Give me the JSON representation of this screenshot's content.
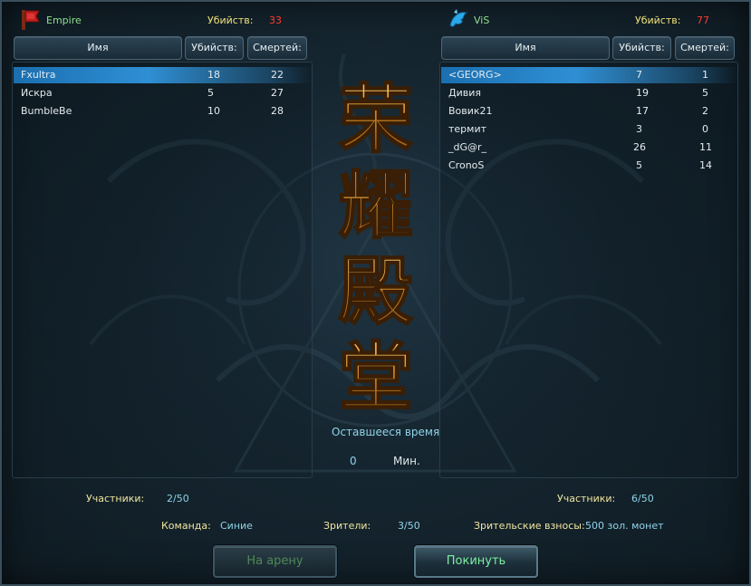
{
  "left_team": {
    "name": "Empire",
    "kills_label": "Убийств:",
    "kills": "33",
    "headers": {
      "name": "Имя",
      "kills": "Убийств:",
      "deaths": "Смертей:"
    },
    "players": [
      {
        "name": "Fxultra",
        "kills": "18",
        "deaths": "22",
        "selected": true
      },
      {
        "name": "Искра",
        "kills": "5",
        "deaths": "27",
        "selected": false
      },
      {
        "name": "BumbleBe",
        "kills": "10",
        "deaths": "28",
        "selected": false
      }
    ],
    "participants_label": "Участники:",
    "participants": "2/50"
  },
  "right_team": {
    "name": "ViS",
    "kills_label": "Убийств:",
    "kills": "77",
    "headers": {
      "name": "Имя",
      "kills": "Убийств:",
      "deaths": "Смертей:"
    },
    "players": [
      {
        "name": "<GEORG>",
        "kills": "7",
        "deaths": "1",
        "selected": true
      },
      {
        "name": "Дивия",
        "kills": "19",
        "deaths": "5",
        "selected": false
      },
      {
        "name": "Вовик21",
        "kills": "17",
        "deaths": "2",
        "selected": false
      },
      {
        "name": "термит",
        "kills": "3",
        "deaths": "0",
        "selected": false
      },
      {
        "name": "_dG@r_",
        "kills": "26",
        "deaths": "11",
        "selected": false
      },
      {
        "name": "CronoS",
        "kills": "5",
        "deaths": "14",
        "selected": false
      }
    ],
    "participants_label": "Участники:",
    "participants": "6/50"
  },
  "center": {
    "title_glyphs": [
      "荣",
      "耀",
      "殿",
      "堂"
    ],
    "time_label": "Оставшееся время",
    "time_value": "0",
    "time_unit": "Мин."
  },
  "footer": {
    "team_label": "Команда:",
    "team_value": "Синие",
    "spectators_label": "Зрители:",
    "spectators_value": "3/50",
    "fee_label": "Зрительские взносы:",
    "fee_value": "500 зол. монет"
  },
  "buttons": {
    "to_arena": "На арену",
    "leave": "Покинуть"
  },
  "colors": {
    "team_name": "#8fe08c",
    "kills_value": "#ff3b30",
    "label_yellow": "#f0e6a0",
    "value_cyan": "#8fd3e8",
    "selection": "#2f8fd4",
    "glyph_gold": "#d89a3a"
  },
  "icons": {
    "left_team": "red-banner-icon",
    "right_team": "blue-dragon-icon"
  }
}
